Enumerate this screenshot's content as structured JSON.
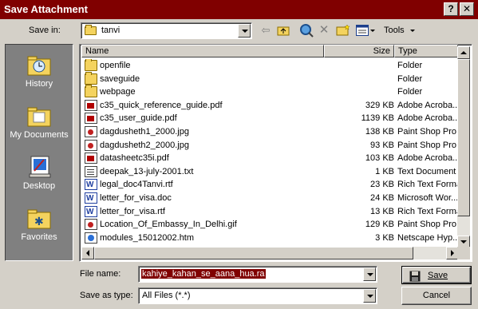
{
  "window": {
    "title": "Save Attachment",
    "help_label": "?",
    "close_label": "✕"
  },
  "toolbar": {
    "save_in_label": "Save in:",
    "save_in_value": "tanvi",
    "tools_label": "Tools"
  },
  "places": [
    {
      "label": "History",
      "icon": "history-icon"
    },
    {
      "label": "My Documents",
      "icon": "my-documents-icon"
    },
    {
      "label": "Desktop",
      "icon": "desktop-icon"
    },
    {
      "label": "Favorites",
      "icon": "favorites-icon"
    }
  ],
  "list": {
    "columns": [
      "Name",
      "Size",
      "Type"
    ],
    "files": [
      {
        "name": "openfile",
        "size": "",
        "type": "Folder",
        "icon": "folder"
      },
      {
        "name": "saveguide",
        "size": "",
        "type": "Folder",
        "icon": "folder"
      },
      {
        "name": "webpage",
        "size": "",
        "type": "Folder",
        "icon": "folder"
      },
      {
        "name": "c35_quick_reference_guide.pdf",
        "size": "329 KB",
        "type": "Adobe Acroba...",
        "icon": "pdf"
      },
      {
        "name": "c35_user_guide.pdf",
        "size": "1139 KB",
        "type": "Adobe Acroba...",
        "icon": "pdf"
      },
      {
        "name": "dagdusheth1_2000.jpg",
        "size": "138 KB",
        "type": "Paint Shop Pro...",
        "icon": "img"
      },
      {
        "name": "dagdusheth2_2000.jpg",
        "size": "93 KB",
        "type": "Paint Shop Pro...",
        "icon": "img"
      },
      {
        "name": "datasheetc35i.pdf",
        "size": "103 KB",
        "type": "Adobe Acroba...",
        "icon": "pdf"
      },
      {
        "name": "deepak_13-july-2001.txt",
        "size": "1 KB",
        "type": "Text Document",
        "icon": "txt"
      },
      {
        "name": "legal_doc4Tanvi.rtf",
        "size": "23 KB",
        "type": "Rich Text Format",
        "icon": "word"
      },
      {
        "name": "letter_for_visa.doc",
        "size": "24 KB",
        "type": "Microsoft Wor...",
        "icon": "word"
      },
      {
        "name": "letter_for_visa.rtf",
        "size": "13 KB",
        "type": "Rich Text Format",
        "icon": "word"
      },
      {
        "name": "Location_Of_Embassy_In_Delhi.gif",
        "size": "129 KB",
        "type": "Paint Shop Pro...",
        "icon": "img"
      },
      {
        "name": "modules_15012002.htm",
        "size": "3 KB",
        "type": "Netscape Hyp...",
        "icon": "htm"
      }
    ]
  },
  "footer": {
    "file_name_label": "File name:",
    "file_name_value": "kahiye_kahan_se_aana_hua.ra",
    "save_as_label": "Save as type:",
    "save_as_value": "All Files (*.*)",
    "save_button": "Save",
    "cancel_button": "Cancel"
  }
}
